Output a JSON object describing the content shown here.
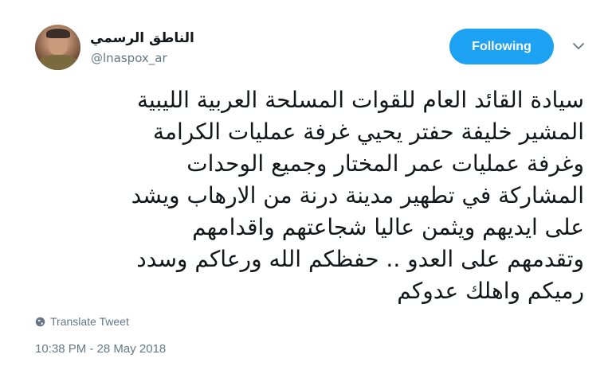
{
  "account": {
    "display_name": "الناطق الرسمي",
    "handle": "@lnaspox_ar"
  },
  "header": {
    "follow_label": "Following"
  },
  "tweet": {
    "lines": [
      "سيادة القائد العام للقوات المسلحة العربية الليبية",
      "المشير خليفة حفتر يحيي غرفة عمليات الكرامة",
      "وغرفة عمليات عمر المختار وجميع الوحدات",
      "المشاركة في تطهير مدينة درنة من الارهاب ويشد",
      "على ايديهم ويثمن عاليا شجاعتهم واقدامهم",
      "وتقدمهم على العدو .. حفظكم الله ورعاكم وسدد",
      "رميكم واهلك عدوكم"
    ],
    "translate_label": "Translate Tweet",
    "timestamp": "10:38 PM - 28 May 2018"
  },
  "icons": {
    "more": "chevron-down-icon",
    "translate": "globe-icon"
  },
  "colors": {
    "accent": "#1da1f2",
    "secondary_text": "#657786",
    "primary_text": "#14171a"
  }
}
